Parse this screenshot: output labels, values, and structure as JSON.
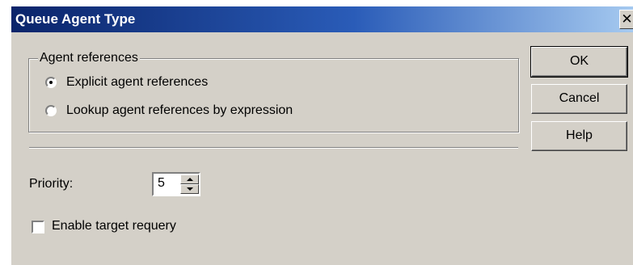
{
  "window": {
    "title": "Queue Agent Type",
    "close_glyph": "✕"
  },
  "agent_references": {
    "legend": "Agent references",
    "options": [
      {
        "label": "Explicit agent references",
        "selected": true
      },
      {
        "label": "Lookup agent references by expression",
        "selected": false
      }
    ]
  },
  "buttons": {
    "ok": "OK",
    "cancel": "Cancel",
    "help": "Help"
  },
  "priority": {
    "label": "Priority:",
    "value": "5"
  },
  "requery": {
    "label": "Enable target requery",
    "checked": false
  },
  "icons": {
    "close": "close-icon",
    "spin_up": "arrow-up-icon",
    "spin_down": "arrow-down-icon"
  },
  "colors": {
    "titlebar_start": "#0a246a",
    "titlebar_end": "#a6caf0",
    "face": "#d4d0c8"
  }
}
